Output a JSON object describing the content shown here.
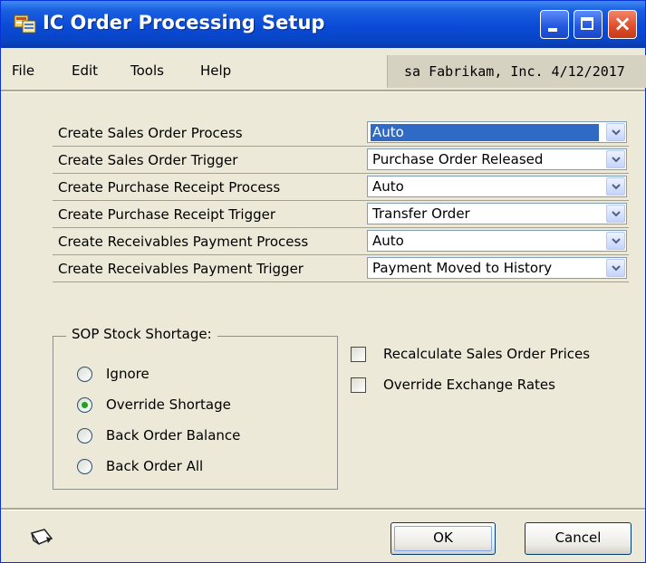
{
  "window": {
    "title": "IC Order Processing Setup",
    "icon": "app-icon",
    "controls": {
      "minimize": "minimize-icon",
      "maximize": "maximize-icon",
      "close": "×"
    }
  },
  "menu": {
    "items": [
      "File",
      "Edit",
      "Tools",
      "Help"
    ],
    "company_info": "sa  Fabrikam, Inc.  4/12/2017"
  },
  "settings": [
    {
      "label": "Create Sales Order Process",
      "value": "Auto",
      "selected": true
    },
    {
      "label": "Create Sales Order Trigger",
      "value": "Purchase Order  Released"
    },
    {
      "label": "Create Purchase Receipt Process",
      "value": "Auto"
    },
    {
      "label": "Create Purchase Receipt Trigger",
      "value": "Transfer Order"
    },
    {
      "label": "Create Receivables Payment Process",
      "value": "Auto"
    },
    {
      "label": "Create Receivables Payment Trigger",
      "value": "Payment Moved to History"
    }
  ],
  "stock_shortage": {
    "title": "SOP Stock Shortage:",
    "options": [
      {
        "label": "Ignore",
        "checked": false
      },
      {
        "label": "Override Shortage",
        "checked": true
      },
      {
        "label": "Back Order Balance",
        "checked": false
      },
      {
        "label": "Back Order All",
        "checked": false
      }
    ]
  },
  "checkboxes": [
    {
      "label": "Recalculate Sales Order Prices",
      "checked": false
    },
    {
      "label": "Override Exchange Rates",
      "checked": false
    }
  ],
  "buttons": {
    "ok": "OK",
    "cancel": "Cancel"
  },
  "colors": {
    "title_bar": "#0a4ad6",
    "selection": "#316ac5",
    "window_bg": "#ece9d8",
    "radio_dot": "#21a121"
  },
  "icons": {
    "note": "note-icon",
    "dropdown": "chevron-down-icon"
  }
}
